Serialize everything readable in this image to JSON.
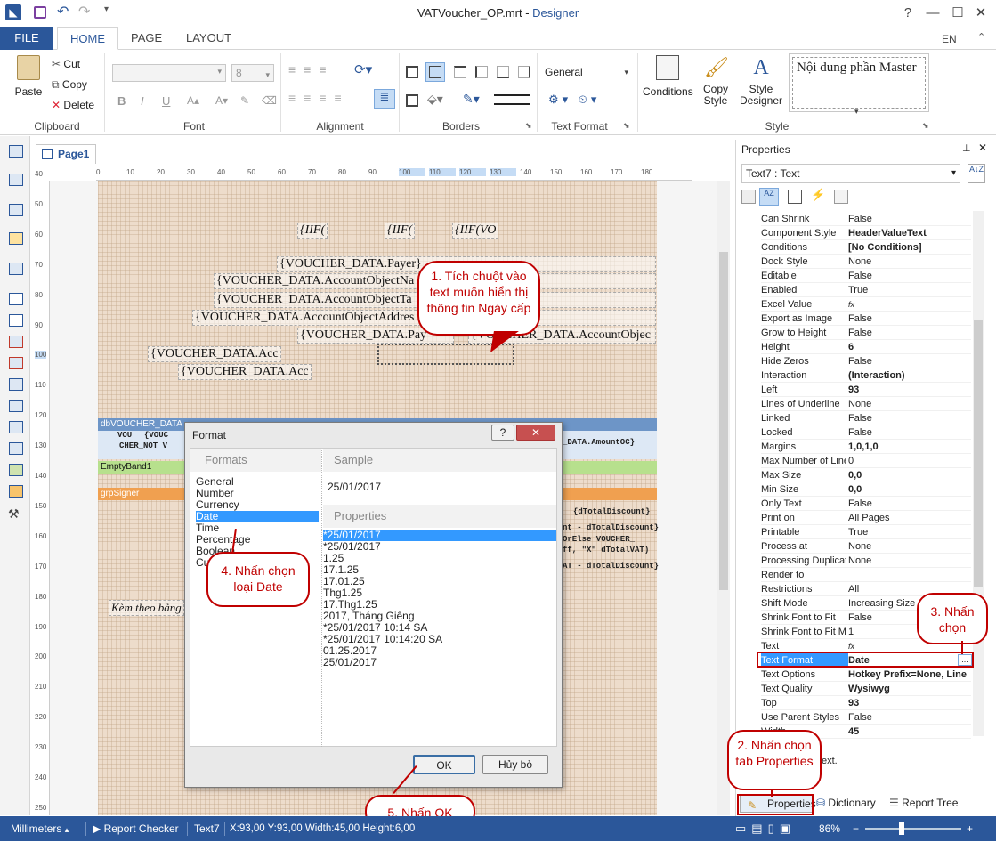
{
  "window": {
    "title": "VATVoucher_OP.mrt",
    "title_sep": " - ",
    "app_name": "Designer"
  },
  "ribbon_tabs": [
    "FILE",
    "HOME",
    "PAGE",
    "LAYOUT"
  ],
  "language": "EN",
  "clipboard": {
    "paste": "Paste",
    "cut": "Cut",
    "copy": "Copy",
    "delete": "Delete",
    "label": "Clipboard"
  },
  "font": {
    "size": "8",
    "label": "Font",
    "bold": "B",
    "italic": "I",
    "underline": "U"
  },
  "alignment": {
    "label": "Alignment"
  },
  "borders": {
    "label": "Borders"
  },
  "text_format": {
    "value": "General",
    "label": "Text Format"
  },
  "style_group": {
    "conditions": "Conditions",
    "copy_style": "Copy Style",
    "style_designer": "Style Designer",
    "preview": "Nội dung phần Master",
    "label": "Style"
  },
  "page_tab": "Page1",
  "hruler_ticks": [
    "0",
    "10",
    "20",
    "30",
    "40",
    "50",
    "60",
    "70",
    "80",
    "90",
    "100",
    "110",
    "120",
    "130",
    "140",
    "150",
    "160",
    "170",
    "180"
  ],
  "vruler_ticks": [
    "40",
    "50",
    "60",
    "70",
    "80",
    "90",
    "100",
    "110",
    "120",
    "130",
    "140",
    "150",
    "160",
    "170",
    "180",
    "190",
    "200",
    "210",
    "220",
    "230",
    "240",
    "250"
  ],
  "report": {
    "iif_fields": [
      "{IIF(",
      "{IIF(",
      "{IIF(VO"
    ],
    "fields": [
      "{VOUCHER_DATA.Payer}",
      "{VOUCHER_DATA.AccountObjectNa",
      "{VOUCHER_DATA.AccountObjectTa",
      "{VOUCHER_DATA.AccountObjectAddres",
      "{VOUCHER_DATA.Pay",
      "{VOUCHER_DATA.AccountObjec",
      "{VOUCHER_DATA.Acc",
      "{VOUCHER_DATA.Acc"
    ],
    "band_detail": "dbVOUCHER_DATA",
    "detail_cells": [
      "VOU",
      "{VOUC",
      "CHER_NOT V",
      "_DATA.AmountOC}"
    ],
    "band_empty": "EmptyBand1",
    "band_signer": "grpSigner",
    "signer_cells": [
      "{dTotalDiscount}",
      "nt - dTotalDiscount}",
      "OrElse VOUCHER_",
      "ff, \"X\" dTotalVAT)",
      "AT - dTotalDiscount}"
    ],
    "kem_theo": "Kèm theo bảng"
  },
  "properties": {
    "header": "Properties",
    "selected": "Text7 : Text",
    "rows": [
      {
        "name": "Can Shrink",
        "value": "False"
      },
      {
        "name": "Component Style",
        "value": "HeaderValueText"
      },
      {
        "name": "Conditions",
        "value": "[No Conditions]"
      },
      {
        "name": "Dock Style",
        "value": "None"
      },
      {
        "name": "Editable",
        "value": "False"
      },
      {
        "name": "Enabled",
        "value": "True"
      },
      {
        "name": "Excel Value",
        "value": "fx"
      },
      {
        "name": "Export as Image",
        "value": "False"
      },
      {
        "name": "Grow to Height",
        "value": "False"
      },
      {
        "name": "Height",
        "value": "6"
      },
      {
        "name": "Hide Zeros",
        "value": "False"
      },
      {
        "name": "Interaction",
        "value": "(Interaction)"
      },
      {
        "name": "Left",
        "value": "93"
      },
      {
        "name": "Lines of Underline",
        "value": "None"
      },
      {
        "name": "Linked",
        "value": "False"
      },
      {
        "name": "Locked",
        "value": "False"
      },
      {
        "name": "Margins",
        "value": "1,0,1,0"
      },
      {
        "name": "Max Number of Lines",
        "value": "0"
      },
      {
        "name": "Max Size",
        "value": "0,0"
      },
      {
        "name": "Min Size",
        "value": "0,0"
      },
      {
        "name": "Only Text",
        "value": "False"
      },
      {
        "name": "Print on",
        "value": "All Pages"
      },
      {
        "name": "Printable",
        "value": "True"
      },
      {
        "name": "Process at",
        "value": "None"
      },
      {
        "name": "Processing Duplicates",
        "value": "None"
      },
      {
        "name": "Render to",
        "value": ""
      },
      {
        "name": "Restrictions",
        "value": "All"
      },
      {
        "name": "Shift Mode",
        "value": "Increasing Size"
      },
      {
        "name": "Shrink Font to Fit",
        "value": "False"
      },
      {
        "name": "Shrink Font to Fit Minimum",
        "value": "1"
      },
      {
        "name": "Text",
        "value": "fx"
      },
      {
        "name": "Text Format",
        "value": "Date"
      },
      {
        "name": "Text Options",
        "value": "Hotkey Prefix=None, Line"
      },
      {
        "name": "Text Quality",
        "value": "Wysiwyg"
      },
      {
        "name": "Top",
        "value": "93"
      },
      {
        "name": "Use Parent Styles",
        "value": "False"
      },
      {
        "name": "Width",
        "value": "45"
      }
    ],
    "desc_tail": "ext.",
    "bottom_tabs": [
      "Properties",
      "Dictionary",
      "Report Tree"
    ]
  },
  "dialog": {
    "title": "Format",
    "formats_header": "Formats",
    "sample_header": "Sample",
    "sample_value": "25/01/2017",
    "properties_header": "Properties",
    "formats": [
      "General",
      "Number",
      "Currency",
      "Date",
      "Time",
      "Percentage",
      "Boolean",
      "Custom"
    ],
    "selected_format": "Date",
    "samples": [
      "*25/01/2017",
      "*25/01/2017",
      "1.25",
      "17.1.25",
      "17.01.25",
      "Thg1.25",
      "17.Thg1.25",
      "2017, Tháng Giêng",
      "*25/01/2017 10:14 SA",
      "*25/01/2017 10:14:20 SA",
      "01.25.2017",
      "25/01/2017"
    ],
    "ok": "OK",
    "cancel": "Hủy bỏ",
    "help": "?"
  },
  "callouts": {
    "c1": "1. Tích chuột vào text muốn hiển thị thông tin Ngày cấp",
    "c2": "2. Nhấn chọn tab Properties",
    "c3": "3. Nhấn chọn",
    "c4": "4. Nhấn chọn loại Date",
    "c5": "5. Nhấn OK"
  },
  "status": {
    "units": "Millimeters",
    "checker": "Report Checker",
    "component": "Text7",
    "coords": "X:93,00  Y:93,00  Width:45,00  Height:6,00",
    "zoom": "86%"
  },
  "colors": {
    "accent": "#2b579a",
    "callout": "#c00000",
    "selection": "#3399ff",
    "band_detail": "#6d95c7",
    "band_empty": "#b7e08d",
    "band_signer": "#f0a050"
  }
}
